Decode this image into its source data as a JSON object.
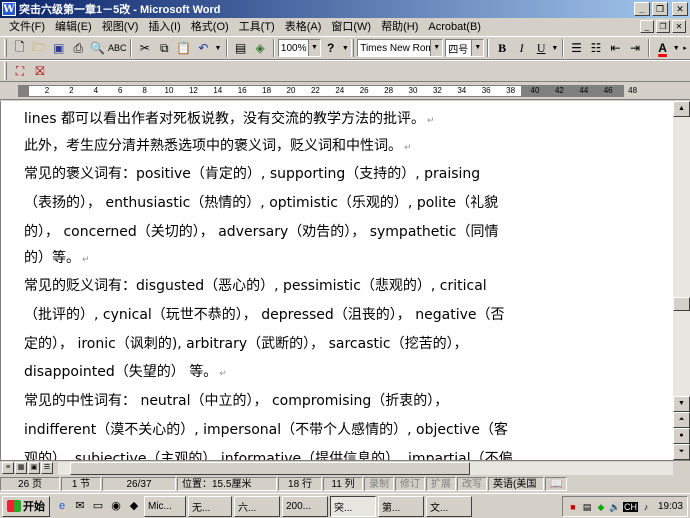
{
  "window": {
    "title": "突击六级第一章1－5改 - Microsoft Word",
    "app_icon": "W"
  },
  "menu": {
    "items": [
      "文件(F)",
      "编辑(E)",
      "视图(V)",
      "插入(I)",
      "格式(O)",
      "工具(T)",
      "表格(A)",
      "窗口(W)",
      "帮助(H)",
      "Acrobat(B)"
    ]
  },
  "toolbar": {
    "zoom": "100%",
    "font_name": "Times New Roman",
    "font_size": "四号",
    "font_color_accent": "#ff0000"
  },
  "ruler": {
    "ticks": [
      "2",
      "2",
      "4",
      "6",
      "8",
      "10",
      "12",
      "14",
      "16",
      "18",
      "20",
      "22",
      "24",
      "26",
      "28",
      "30",
      "32",
      "34",
      "36",
      "38",
      "40",
      "42",
      "44",
      "46",
      "48"
    ]
  },
  "document": {
    "lines": [
      "lines  都可以看出作者对死板说教，没有交流的教学方法的批评。",
      "    此外，考生应分清并熟悉选项中的褒义词，贬义词和中性词。",
      "    常见的褒义词有：positive（肯定的）, supporting（支持的）, praising",
      "（表扬的）， enthusiastic（热情的）, optimistic（乐观的）, polite（礼貌",
      "的）， concerned（关切的）， adversary（劝告的）， sympathetic（同情",
      "的）等。",
      "    常见的贬义词有：disgusted（恶心的）, pessimistic（悲观的）, critical",
      "（批评的）, cynical（玩世不恭的）， depressed（沮丧的）， negative（否",
      "定的）， ironic（讽刺的), arbitrary（武断的）， sarcastic（挖苦的），",
      "disappointed（失望的）  等。",
      "    常见的中性词有： neutral（中立的）， compromising（折衷的），",
      "indifferent（漠不关心的）, impersonal（不带个人感情的）, objective（客",
      "观的）, subjective（主观的）,informative（提供信息的）, impartial（不偏"
    ]
  },
  "status": {
    "page": "26 页",
    "section": "1 节",
    "page_of": "26/37",
    "position": "位置：15.5厘米",
    "line": "18 行",
    "column": "11 列",
    "rec": "录制",
    "trk": "修订",
    "ext": "扩展",
    "ovr": "改写",
    "lang": "英语(美国"
  },
  "taskbar": {
    "start": "开始",
    "tasks": [
      "Mic...",
      "无...",
      "六...",
      "200...",
      "突...",
      "第...",
      "文..."
    ],
    "ime": "CH",
    "clock": "19:03"
  }
}
